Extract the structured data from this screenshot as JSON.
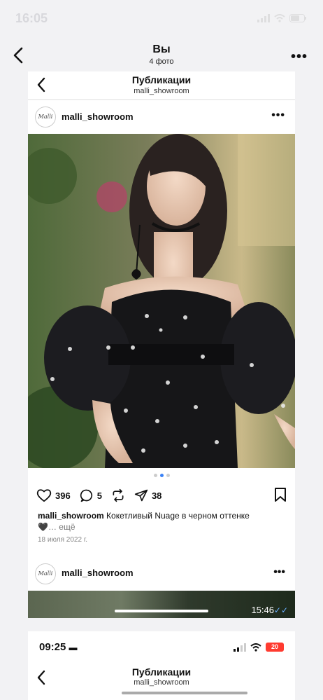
{
  "status": {
    "time": "16:05"
  },
  "header": {
    "title": "Вы",
    "subtitle": "4 фото"
  },
  "screenshot1": {
    "nav_title": "Публикации",
    "nav_subtitle": "malli_showroom",
    "avatar_text": "Malli",
    "username": "malli_showroom",
    "photo_pager": {
      "count": 3,
      "active_index": 1
    },
    "likes": "396",
    "comments": "5",
    "shares": "38",
    "caption_user": "malli_showroom",
    "caption_text": "Кокетливый Nuage в черном оттенке",
    "caption_heart": "🖤",
    "caption_more": "… ещё",
    "date": "18 июля 2022 г.",
    "next_post_username": "malli_showroom",
    "message_time": "15:46",
    "message_checks": "✓✓"
  },
  "screenshot2": {
    "time": "09:25",
    "battery": "20",
    "nav_title": "Публикации",
    "nav_subtitle": "malli_showroom"
  },
  "colors": {
    "accent": "#3b82f6",
    "battery_low": "#ff3b30"
  }
}
